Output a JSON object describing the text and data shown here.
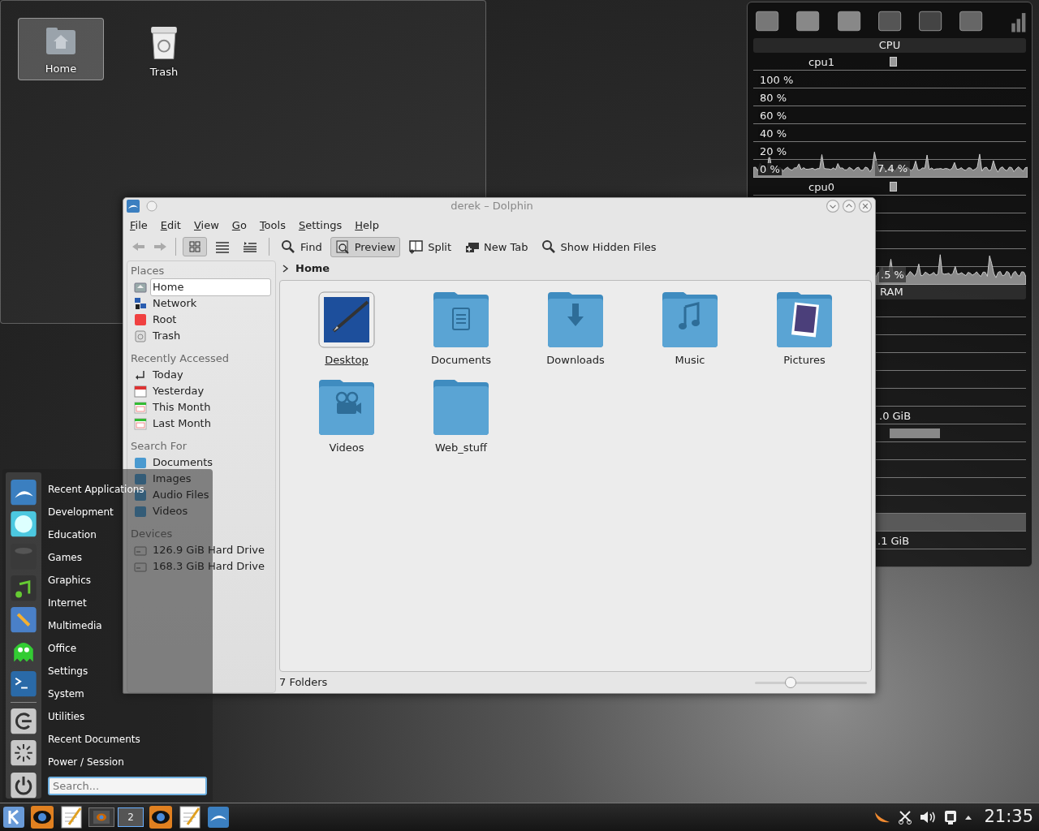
{
  "desktop_icons": [
    {
      "label": "Home",
      "selected": true
    },
    {
      "label": "Trash",
      "selected": false
    }
  ],
  "system_monitor": {
    "cpu_title": "CPU",
    "cpu1": {
      "label": "cpu1",
      "axis_labels": [
        "100 %",
        "80 %",
        "60 %",
        "40 %",
        "20 %",
        "0 %"
      ],
      "reading": "7.4 %"
    },
    "cpu0": {
      "label": "cpu0",
      "reading": ".5 %"
    },
    "ram_title": "RAM",
    "ram_readings": [
      ".0 GiB",
      ".1 GiB"
    ]
  },
  "dolphin": {
    "title": "derek – Dolphin",
    "menu": [
      "File",
      "Edit",
      "View",
      "Go",
      "Tools",
      "Settings",
      "Help"
    ],
    "view_modes": [
      {
        "kind": "icons",
        "selected": true
      },
      {
        "kind": "details",
        "selected": false
      },
      {
        "kind": "compact",
        "selected": false
      }
    ],
    "toolbar": [
      {
        "kind": "find",
        "label": "Find",
        "selected": false
      },
      {
        "kind": "preview",
        "label": "Preview",
        "selected": true
      },
      {
        "kind": "split",
        "label": "Split",
        "selected": false
      },
      {
        "kind": "newtab",
        "label": "New Tab",
        "selected": false
      },
      {
        "kind": "hidden",
        "label": "Show Hidden Files",
        "selected": false
      }
    ],
    "sidebar": [
      {
        "heading": "Places",
        "items": [
          {
            "label": "Home",
            "selected": true
          },
          {
            "label": "Network",
            "selected": false
          },
          {
            "label": "Root",
            "selected": false
          },
          {
            "label": "Trash",
            "selected": false
          }
        ]
      },
      {
        "heading": "Recently Accessed",
        "items": [
          {
            "label": "Today",
            "selected": false
          },
          {
            "label": "Yesterday",
            "selected": false
          },
          {
            "label": "This Month",
            "selected": false
          },
          {
            "label": "Last Month",
            "selected": false
          }
        ]
      },
      {
        "heading": "Search For",
        "items": [
          {
            "label": "Documents",
            "selected": false
          },
          {
            "label": "Images",
            "selected": false
          },
          {
            "label": "Audio Files",
            "selected": false
          },
          {
            "label": "Videos",
            "selected": false
          }
        ]
      },
      {
        "heading": "Devices",
        "items": [
          {
            "label": "126.9 GiB Hard Drive",
            "selected": false
          },
          {
            "label": "168.3 GiB Hard Drive",
            "selected": false
          }
        ]
      }
    ],
    "breadcrumb": "Home",
    "items": [
      {
        "label": "Desktop",
        "kind": "desktop",
        "selected": true
      },
      {
        "label": "Documents",
        "kind": "documents",
        "selected": false
      },
      {
        "label": "Downloads",
        "kind": "downloads",
        "selected": false
      },
      {
        "label": "Music",
        "kind": "music",
        "selected": false
      },
      {
        "label": "Pictures",
        "kind": "pictures",
        "selected": false
      },
      {
        "label": "Videos",
        "kind": "videos",
        "selected": false
      },
      {
        "label": "Web_stuff",
        "kind": "folder",
        "selected": false
      }
    ],
    "status": "7 Folders",
    "zoom": {
      "level": 0.32
    }
  },
  "launcher": {
    "categories": [
      "Recent Applications",
      "Development",
      "Education",
      "Games",
      "Graphics",
      "Internet",
      "Multimedia",
      "Office",
      "Settings",
      "System",
      "Utilities",
      "Recent Documents",
      "Power / Session"
    ],
    "search": {
      "placeholder": "Search..."
    }
  },
  "taskbar": {
    "pager": [
      {
        "selected": false
      },
      {
        "label": "2",
        "selected": true
      }
    ],
    "clock": "21:35"
  }
}
